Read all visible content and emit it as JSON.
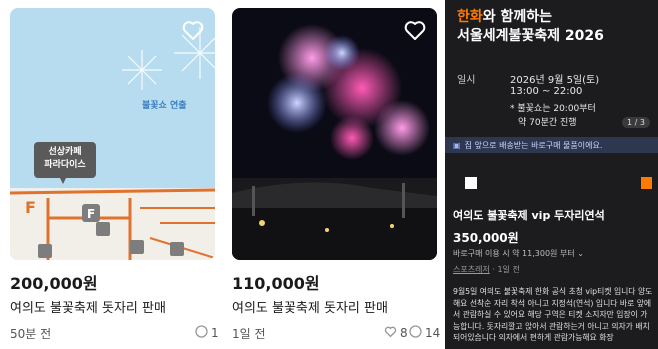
{
  "listings": [
    {
      "price": "200,000원",
      "title": "여의도 불꽃축제 돗자리 판매",
      "time_ago": "50분 전",
      "chat_count": "1",
      "map_label_cafe": "선상카페\n파라다이스",
      "map_label_show": "불꽃쇼 연출"
    },
    {
      "price": "110,000원",
      "title": "여의도 불꽃축제 돗자리 판매",
      "time_ago": "1일 전",
      "like_count": "8",
      "chat_count": "14"
    }
  ],
  "detail": {
    "banner_brand": "한화",
    "banner_line1_rest": "와 함께하는",
    "banner_line2": "서울세계불꽃축제 2026",
    "date_label": "일시",
    "date_value": "2026년 9월 5일(토)",
    "time_value": "13:00 ~ 22:00",
    "note1": "* 불꽃쇼는 20:00부터",
    "note2": "약 70분간 진행",
    "page_indicator": "1 / 3",
    "promo_text": "집 앞으로 배송받는 바로구매 물품이에요.",
    "title": "여의도 불꽃축제 vip 두자리연석",
    "price": "350,000원",
    "installment": "바로구매 이용 시 약 11,300원 부터 ⌄",
    "category": "스포츠레저",
    "posted": "1일 전",
    "description": "9월5일 여의도 불꽃축제 한화 공식 초청 vip티켓 입니다 양도해요 선착순 자리 착석 아니고 지정석(연석) 입니다 바로 앞에서 관람하실 수 있어요 해당 구역은 티켓 소지자만 입장이 가능합니다. 돗자리깔고 앉아서 관람하는거 아니고 의자가 배치 되어있습니다 의자에서 편하게 관람가능해요 화장"
  },
  "colors": {
    "brand": "#ff7a00",
    "dark_bg": "#1c1c1e",
    "promo_bg": "#2e3750"
  }
}
